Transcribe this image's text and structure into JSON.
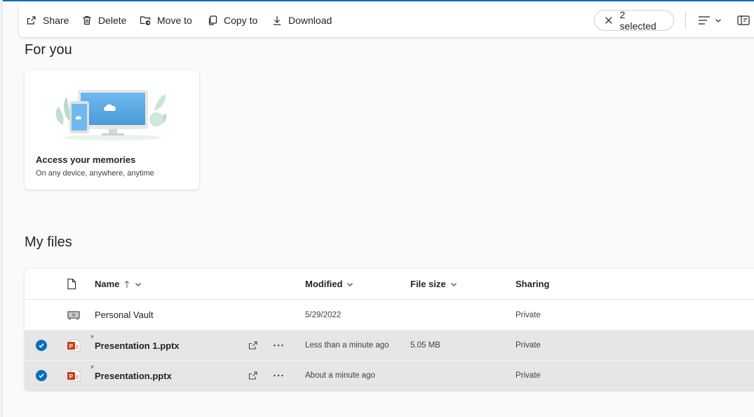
{
  "toolbar": {
    "share_label": "Share",
    "delete_label": "Delete",
    "move_label": "Move to",
    "copy_label": "Copy to",
    "download_label": "Download",
    "selected_label": "2 selected"
  },
  "for_you": {
    "title": "For you",
    "card_title": "Access your memories",
    "card_subtitle": "On any device, anywhere, anytime"
  },
  "my_files": {
    "title": "My files",
    "columns": {
      "name": "Name",
      "modified": "Modified",
      "size": "File size",
      "sharing": "Sharing"
    },
    "rows": [
      {
        "name": "Personal Vault",
        "modified": "5/29/2022",
        "size": "",
        "sharing": "Private",
        "selected": false
      },
      {
        "name": "Presentation 1.pptx",
        "modified": "Less than a minute ago",
        "size": "5.05 MB",
        "sharing": "Private",
        "selected": true
      },
      {
        "name": "Presentation.pptx",
        "modified": "About a minute ago",
        "size": "",
        "sharing": "Private",
        "selected": true
      }
    ]
  },
  "colors": {
    "accent": "#0f6cbd",
    "selected_row": "#e6e6e6",
    "ppt": "#c43e1c"
  }
}
